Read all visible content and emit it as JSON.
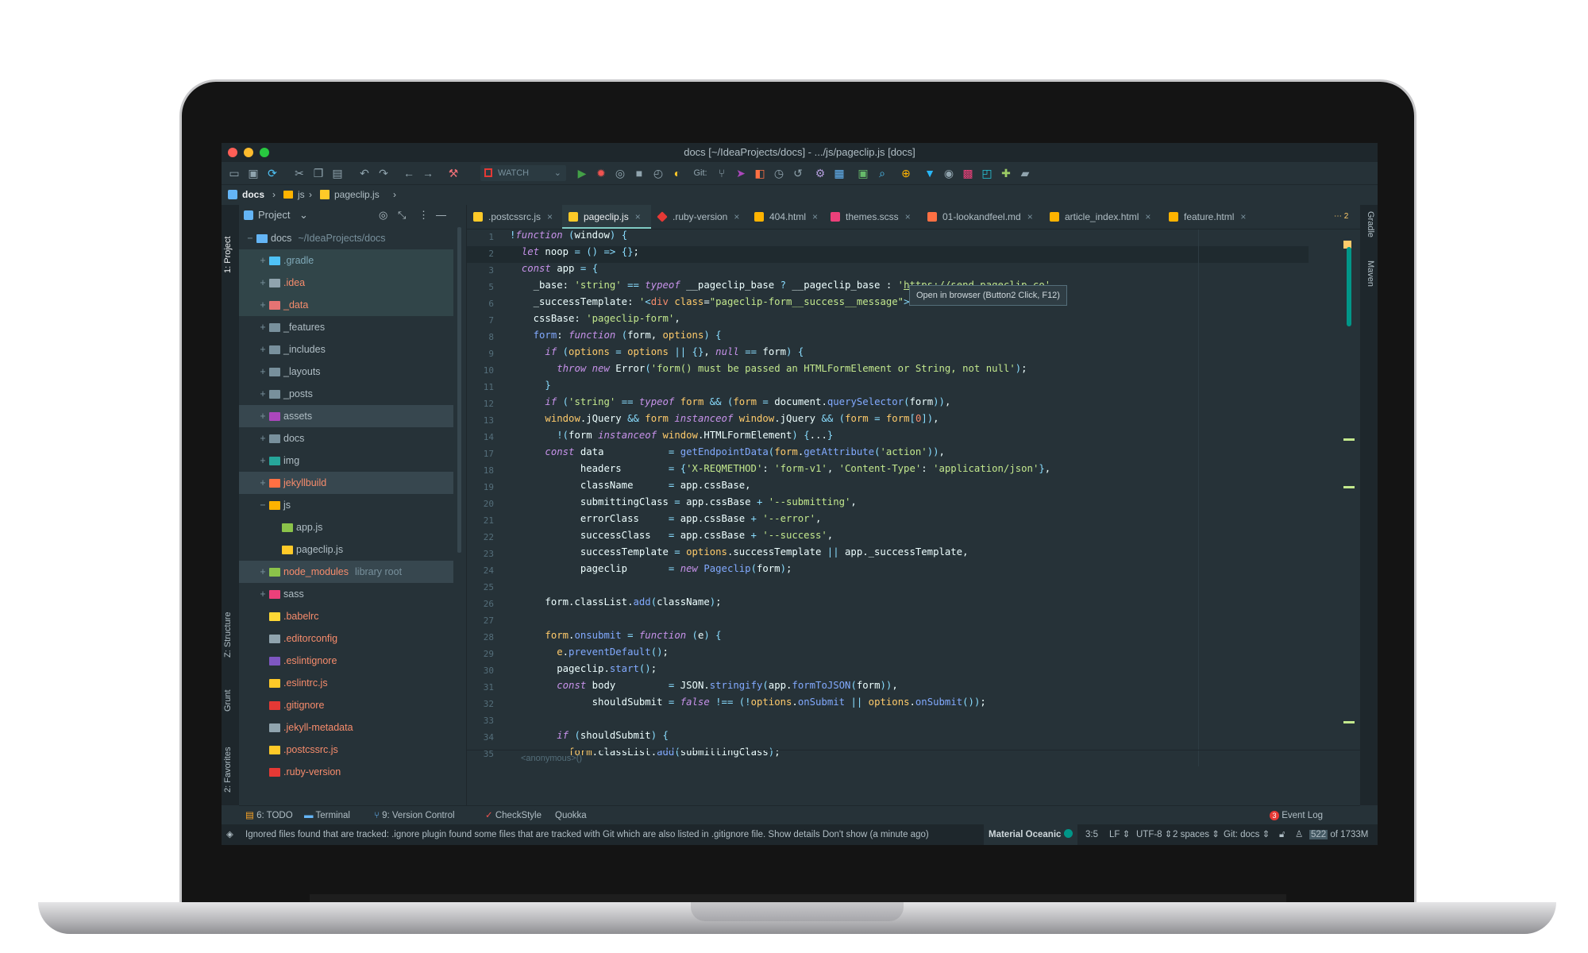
{
  "window": {
    "title": "docs [~/IdeaProjects/docs] - .../js/pageclip.js [docs]"
  },
  "toolbar": {
    "run_config": "WATCH",
    "git_label": "Git:"
  },
  "breadcrumb": {
    "items": [
      "docs",
      "js",
      "pageclip.js"
    ]
  },
  "left_strip": {
    "project": "1: Project",
    "structure": "Z: Structure",
    "grunt": "Grunt",
    "favorites": "2: Favorites"
  },
  "right_strip": {
    "gradle": "Gradle",
    "maven": "Maven"
  },
  "project_panel": {
    "title": "Project",
    "tree": [
      {
        "label": "docs",
        "extra": "~/IdeaProjects/docs",
        "color": "#b0bec5"
      },
      {
        "label": ".gradle",
        "color": "#7fa9b8"
      },
      {
        "label": ".idea",
        "color": "#f78c6c"
      },
      {
        "label": "_data",
        "color": "#f78c6c"
      },
      {
        "label": "_features",
        "color": "#b0bec5"
      },
      {
        "label": "_includes",
        "color": "#b0bec5"
      },
      {
        "label": "_layouts",
        "color": "#b0bec5"
      },
      {
        "label": "_posts",
        "color": "#b0bec5"
      },
      {
        "label": "assets",
        "color": "#b0bec5"
      },
      {
        "label": "docs",
        "color": "#b0bec5"
      },
      {
        "label": "img",
        "color": "#b0bec5"
      },
      {
        "label": "jekyllbuild",
        "color": "#f78c6c"
      },
      {
        "label": "js",
        "color": "#b0bec5"
      },
      {
        "label": "app.js",
        "color": "#b0bec5"
      },
      {
        "label": "pageclip.js",
        "color": "#b0bec5"
      },
      {
        "label": "node_modules",
        "extra": "library root",
        "color": "#f78c6c"
      },
      {
        "label": "sass",
        "color": "#b0bec5"
      },
      {
        "label": ".babelrc",
        "color": "#f78c6c"
      },
      {
        "label": ".editorconfig",
        "color": "#f78c6c"
      },
      {
        "label": ".eslintignore",
        "color": "#f78c6c"
      },
      {
        "label": ".eslintrc.js",
        "color": "#f78c6c"
      },
      {
        "label": ".gitignore",
        "color": "#f78c6c"
      },
      {
        "label": ".jekyll-metadata",
        "color": "#f78c6c"
      },
      {
        "label": ".postcssrc.js",
        "color": "#f78c6c"
      },
      {
        "label": ".ruby-version",
        "color": "#f78c6c"
      }
    ]
  },
  "tabs": [
    {
      "label": ".postcssrc.js"
    },
    {
      "label": "pageclip.js"
    },
    {
      "label": ".ruby-version"
    },
    {
      "label": "404.html"
    },
    {
      "label": "themes.scss"
    },
    {
      "label": "01-lookandfeel.md"
    },
    {
      "label": "article_index.html"
    },
    {
      "label": "feature.html"
    }
  ],
  "tabs_overflow": "2",
  "editor": {
    "line_numbers": [
      "1",
      "2",
      "3",
      "5",
      "6",
      "7",
      "8",
      "9",
      "10",
      "11",
      "12",
      "13",
      "14",
      "17",
      "18",
      "19",
      "20",
      "21",
      "22",
      "23",
      "24",
      "25",
      "26",
      "27",
      "28",
      "29",
      "30",
      "31",
      "32",
      "33",
      "34",
      "35"
    ],
    "tooltip": "Open in browser (Button2 Click, F12)",
    "scope_crumb": "<anonymous>()"
  },
  "tool_windows": [
    {
      "label": "6: TODO"
    },
    {
      "label": "Terminal"
    },
    {
      "label": "9: Version Control"
    },
    {
      "label": "CheckStyle"
    },
    {
      "label": "Quokka"
    }
  ],
  "event_log": {
    "count": "3",
    "label": "Event Log"
  },
  "status": {
    "message": "Ignored files found that are tracked: .ignore plugin found some files that are tracked with Git which are also listed in .gitignore file. Show details Don't show (a minute ago)",
    "theme": "Material Oceanic",
    "position": "3:5",
    "line_sep": "LF",
    "encoding": "UTF-8",
    "indent": "2 spaces",
    "git_branch": "Git: docs",
    "memory_used": "522",
    "memory_total": "of 1733M"
  },
  "colors": {
    "bg": "#263238",
    "accent": "#009688",
    "active_tab": "#80cbc4"
  }
}
